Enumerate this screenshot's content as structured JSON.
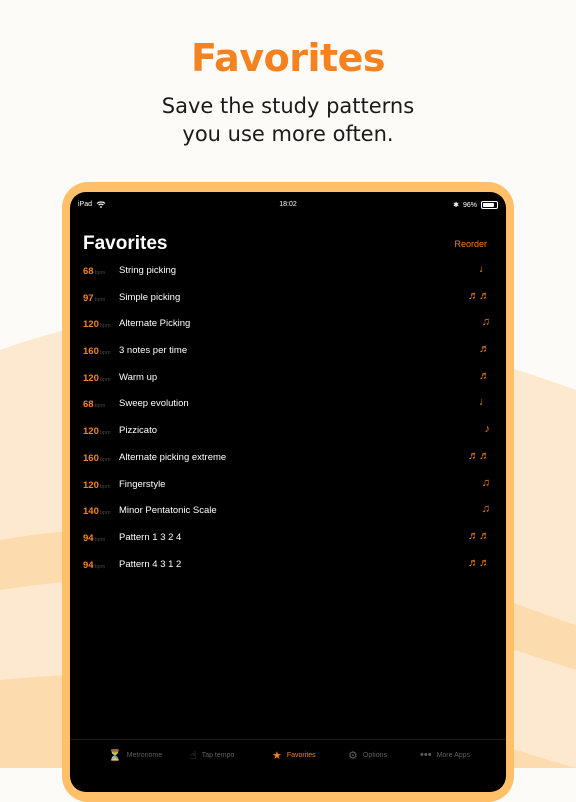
{
  "headline": "Favorites",
  "subhead": [
    "Save the study patterns",
    "you use more often."
  ],
  "colors": {
    "accent": "#f58220",
    "frame": "#ffc069",
    "screen": "#000000"
  },
  "status_bar": {
    "device": "iPad",
    "time": "18:02",
    "battery": "96%"
  },
  "nav": {
    "title": "Favorites",
    "reorder": "Reorder"
  },
  "bpm_unit": "bpm",
  "favorites": [
    {
      "bpm": "68",
      "name": "String picking",
      "note": "♩"
    },
    {
      "bpm": "97",
      "name": "Simple picking",
      "note": "♬♬"
    },
    {
      "bpm": "120",
      "name": "Alternate Picking",
      "note": "♫"
    },
    {
      "bpm": "160",
      "name": "3 notes per time",
      "note": "♬"
    },
    {
      "bpm": "120",
      "name": "Warm up",
      "note": "♬"
    },
    {
      "bpm": "68",
      "name": "Sweep evolution",
      "note": "♩"
    },
    {
      "bpm": "120",
      "name": "Pizzicato",
      "note": "♪"
    },
    {
      "bpm": "160",
      "name": "Alternate picking extreme",
      "note": "♬♬"
    },
    {
      "bpm": "120",
      "name": "Fingerstyle",
      "note": "♫"
    },
    {
      "bpm": "140",
      "name": "Minor Pentatonic Scale",
      "note": "♫"
    },
    {
      "bpm": "94",
      "name": "Pattern 1 3 2 4",
      "note": "♬♬"
    },
    {
      "bpm": "94",
      "name": "Pattern 4 3 1 2",
      "note": "♬♬"
    }
  ],
  "tabs": [
    {
      "label": "Metronome",
      "icon": "metronome-icon",
      "glyph": "⏳",
      "active": false
    },
    {
      "label": "Tap tempo",
      "icon": "tap-hand-icon",
      "glyph": "☝",
      "active": false
    },
    {
      "label": "Favorites",
      "icon": "star-list-icon",
      "glyph": "★",
      "active": true
    },
    {
      "label": "Options",
      "icon": "gear-icon",
      "glyph": "⚙",
      "active": false
    },
    {
      "label": "More Apps",
      "icon": "dots-icon",
      "glyph": "•••",
      "active": false
    }
  ]
}
